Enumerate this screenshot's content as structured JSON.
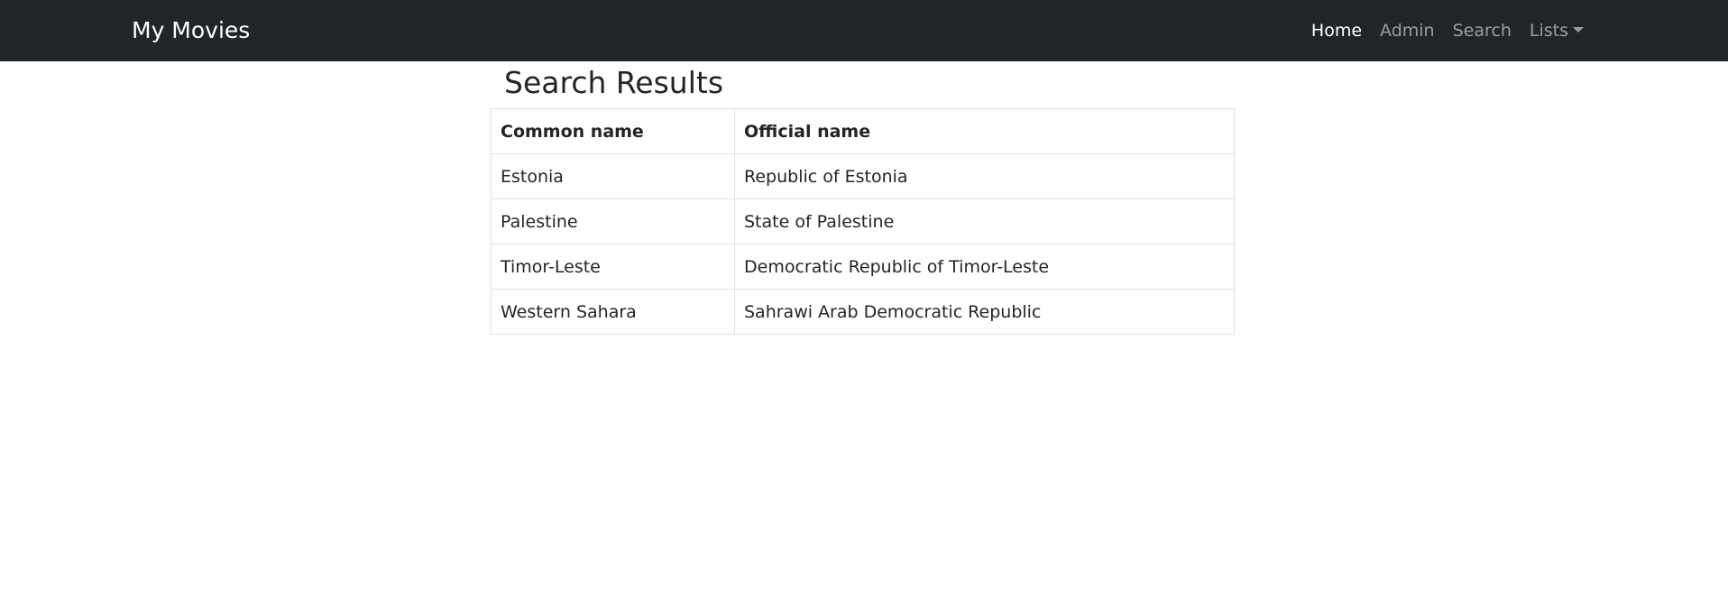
{
  "navbar": {
    "brand": "My Movies",
    "links": [
      {
        "label": "Home",
        "active": true
      },
      {
        "label": "Admin",
        "active": false
      },
      {
        "label": "Search",
        "active": false
      },
      {
        "label": "Lists",
        "active": false,
        "dropdown": true
      }
    ]
  },
  "page": {
    "title": "Search Results"
  },
  "table": {
    "headers": [
      "Common name",
      "Official name"
    ],
    "rows": [
      [
        "Estonia",
        "Republic of Estonia"
      ],
      [
        "Palestine",
        "State of Palestine"
      ],
      [
        "Timor-Leste",
        "Democratic Republic of Timor-Leste"
      ],
      [
        "Western Sahara",
        "Sahrawi Arab Democratic Republic"
      ]
    ]
  },
  "colors": {
    "navbar_bg": "#212529",
    "text": "#212529",
    "border": "#dee2e6"
  }
}
